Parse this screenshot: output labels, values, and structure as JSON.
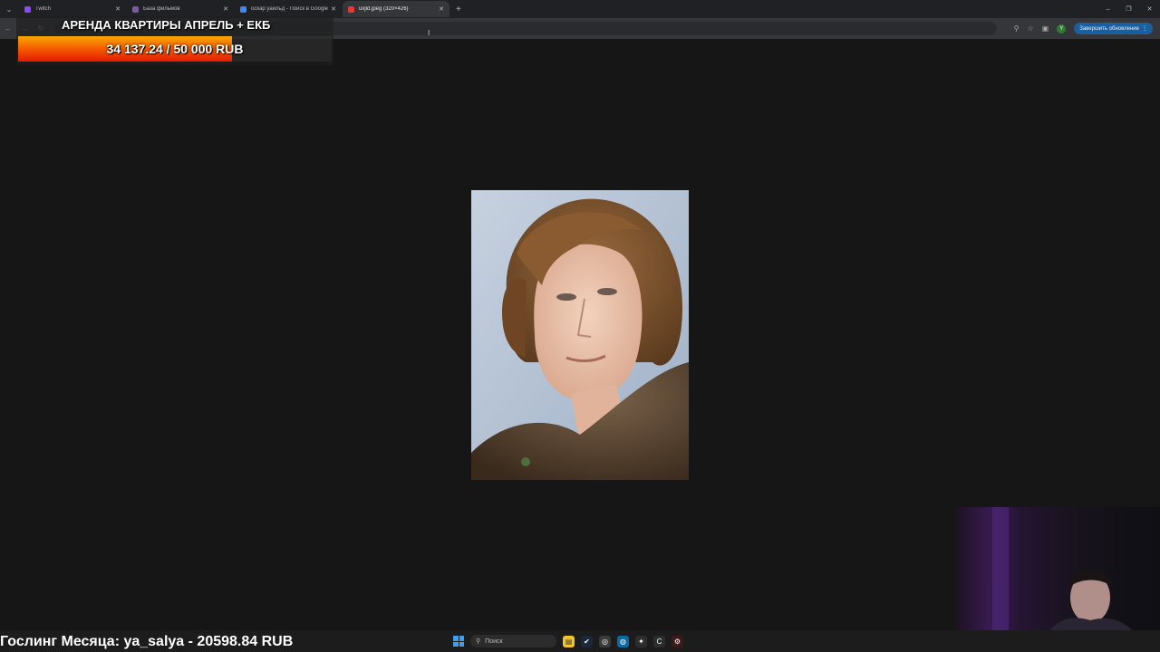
{
  "browser": {
    "tabs": [
      {
        "label": "Twitch",
        "active": false,
        "favicon_color": "#9146ff"
      },
      {
        "label": "База фильмов",
        "active": false,
        "favicon_color": "#7a5c9e"
      },
      {
        "label": "оскар уайльд - Поиск в Google",
        "active": false,
        "favicon_color": "#4285f4"
      },
      {
        "label": "uxjld.jpeg (320×426)",
        "active": true,
        "favicon_color": "#e53935"
      }
    ],
    "update_button": "Завершить обновление",
    "profile_initial": "Y"
  },
  "goal": {
    "title": "АРЕНДА КВАРТИРЫ АПРЕЛЬ + ЕКБ",
    "amount_text": "34 137.24 / 50 000 RUB",
    "progress": 0.683,
    "fill_colors": [
      "#f9a800",
      "#e51a00"
    ]
  },
  "ticker": {
    "text": "Гослинг Месяца: ya_salya - 20598.84 RUB"
  },
  "taskbar": {
    "search_placeholder": "Поиск"
  }
}
